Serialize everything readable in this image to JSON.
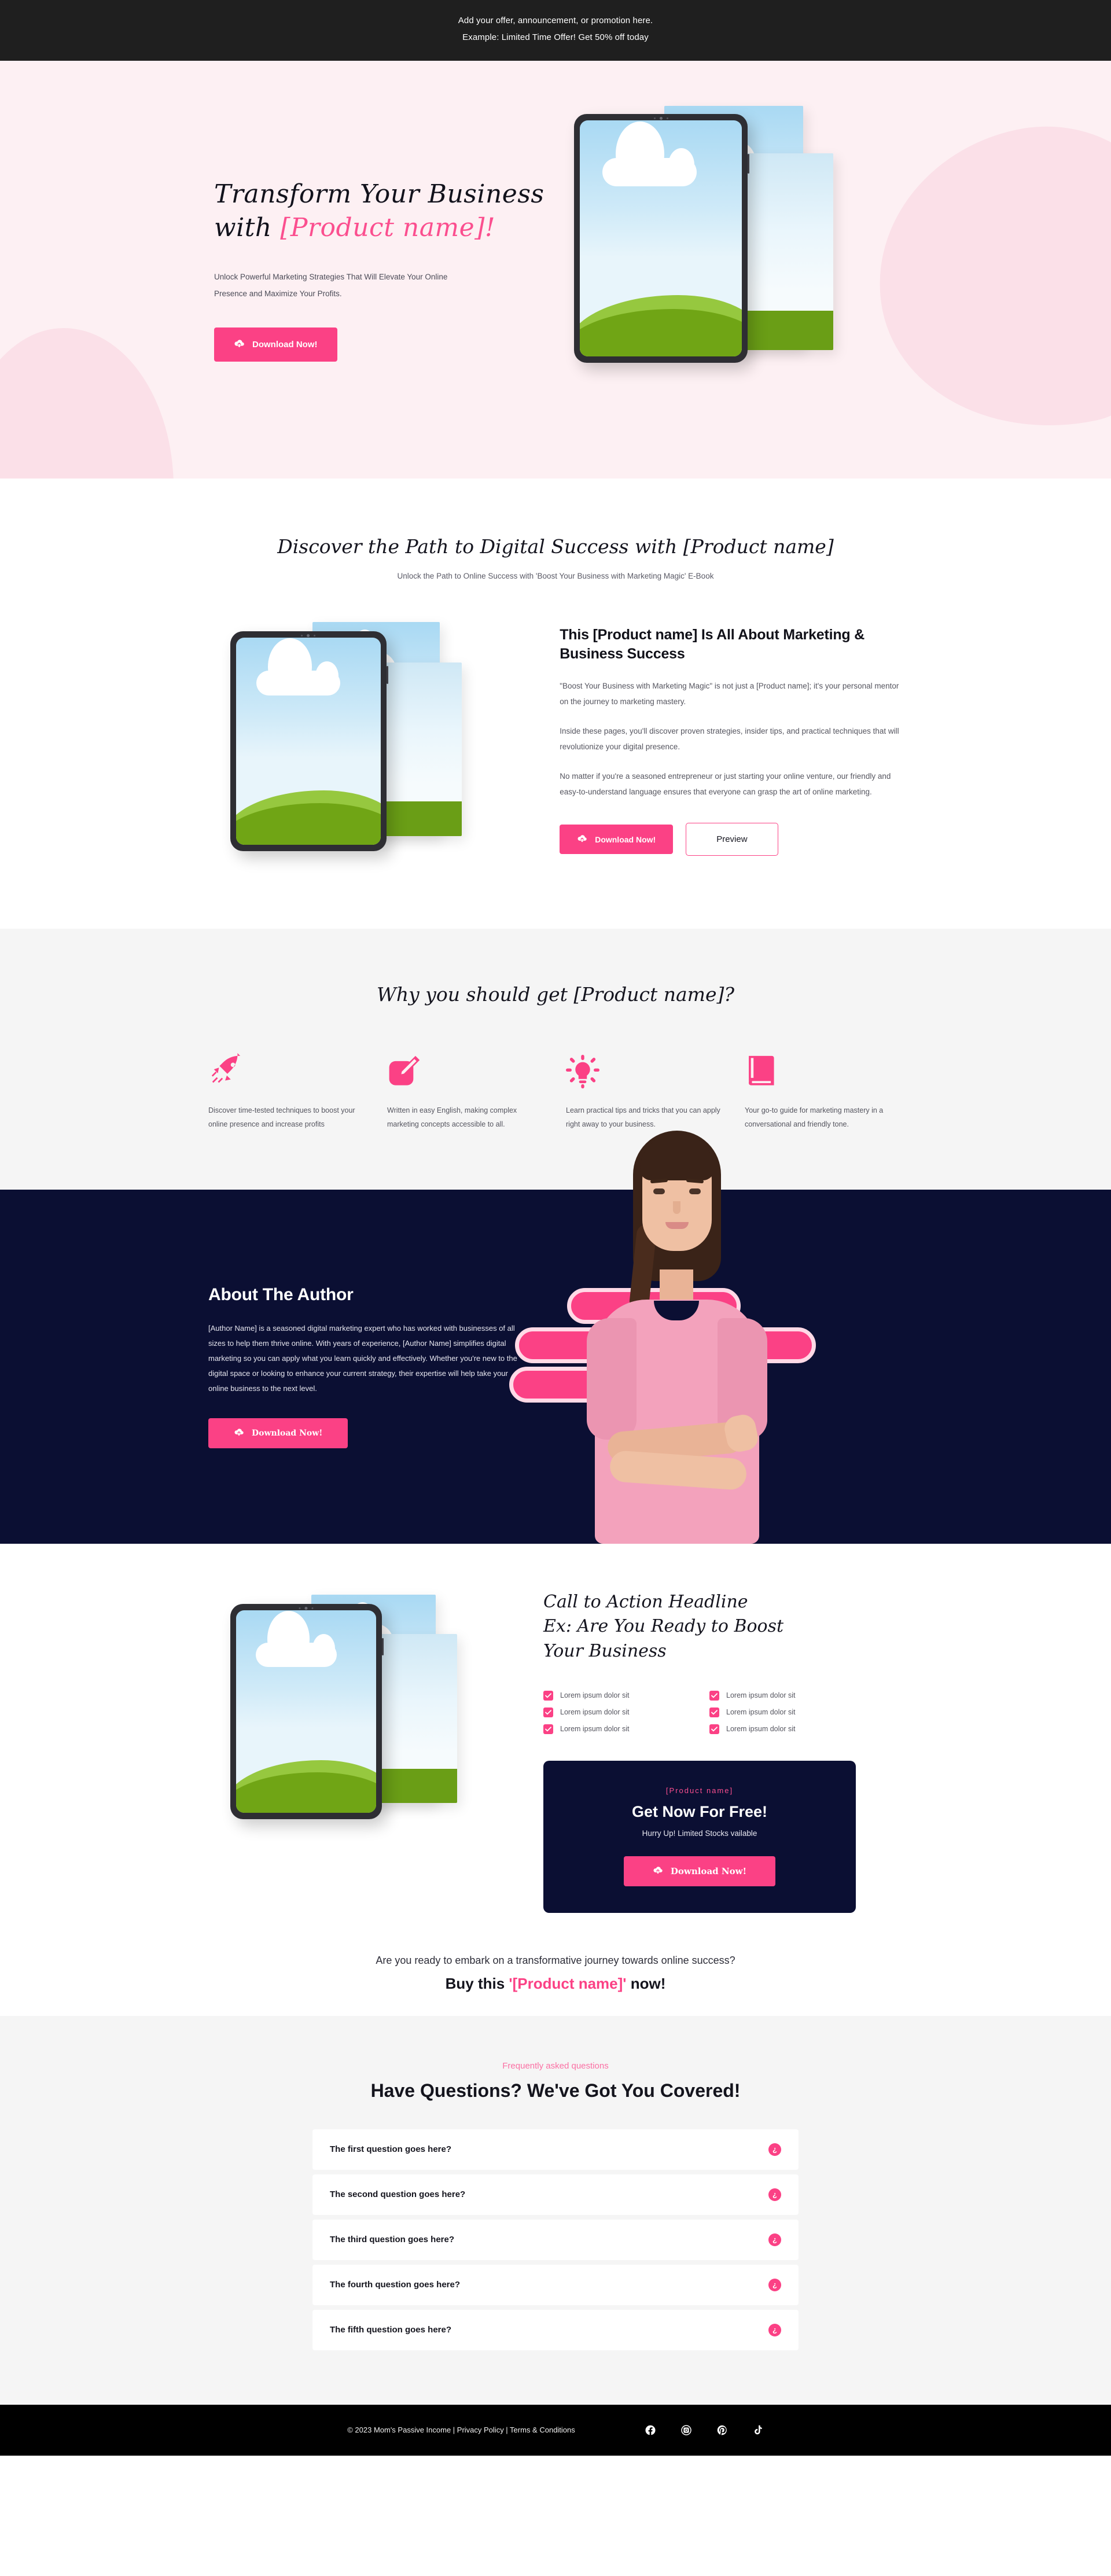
{
  "announcement": {
    "line1": "Add your offer, announcement, or promotion here.",
    "line2": "Example: Limited Time Offer! Get 50% off today"
  },
  "hero": {
    "heading_line1": "Transform Your Business",
    "heading_line2_prefix": "with ",
    "heading_line2_accent": "[Product name]!",
    "subtext": "Unlock Powerful Marketing Strategies That Will Elevate Your Online Presence and Maximize Your Profits.",
    "cta_label": "Download Now!",
    "cta_icon": "cloud-download-icon"
  },
  "discover": {
    "title": "Discover the Path to Digital Success with [Product name]",
    "subtitle": "Unlock the Path to Online Success with 'Boost Your Business with Marketing Magic' E-Book",
    "copy_heading": "This [Product name] Is All About Marketing & Business Success",
    "paragraphs": [
      "\"Boost Your Business with Marketing Magic\" is not just a [Product name]; it's your personal mentor on the journey to marketing mastery.",
      "Inside these pages, you'll discover proven strategies, insider tips, and practical techniques that will revolutionize your digital presence.",
      "No matter if you're a seasoned entrepreneur or just starting your online venture, our friendly and easy-to-understand language ensures that everyone can grasp the art of online marketing."
    ],
    "primary_cta": "Download Now!",
    "secondary_cta": "Preview"
  },
  "why": {
    "title": "Why you should get [Product name]?",
    "items": [
      {
        "icon": "rocket-icon",
        "text": "Discover time-tested techniques to boost your online presence and increase profits"
      },
      {
        "icon": "pencil-square-icon",
        "text": "Written in easy English, making complex marketing concepts accessible to all."
      },
      {
        "icon": "lightbulb-icon",
        "text": "Learn practical tips and tricks that you can apply right away to your business."
      },
      {
        "icon": "book-icon",
        "text": "Your go-to guide for marketing mastery in a conversational and friendly tone."
      }
    ]
  },
  "author": {
    "title": "About The Author",
    "body": "[Author Name] is a seasoned digital marketing expert who has worked with businesses of all sizes to help them thrive online. With years of experience, [Author Name] simplifies digital marketing so you can apply what you learn quickly and effectively. Whether you're new to the digital space or looking to enhance your current strategy, their expertise will help take your online business to the next level.",
    "cta_label": "Download Now!"
  },
  "cta": {
    "heading_line1": "Call to Action Headline",
    "heading_line2": "Ex: Are You Ready to Boost",
    "heading_line3": "Your Business",
    "checklist": [
      "Lorem ipsum dolor sit",
      "Lorem ipsum dolor sit",
      "Lorem ipsum dolor sit",
      "Lorem ipsum dolor sit",
      "Lorem ipsum dolor sit",
      "Lorem ipsum dolor sit"
    ],
    "offer_kicker": "[Product name]",
    "offer_heading": "Get Now For Free!",
    "offer_sub": "Hurry Up! Limited Stocks vailable",
    "offer_cta": "Download Now!",
    "closing_line1": "Are you ready to embark on a transformative journey towards online success?",
    "closing_prefix": "Buy this ",
    "closing_accent": "'[Product name]'",
    "closing_suffix": " now!"
  },
  "faq": {
    "kicker": "Frequently asked questions",
    "title": "Have Questions? We've Got You Covered!",
    "toggle_glyph": "¿",
    "items": [
      "The first question goes here?",
      "The second question goes here?",
      "The third question goes here?",
      "The fourth question goes here?",
      "The fifth question goes here?"
    ]
  },
  "footer": {
    "copyright": "© 2023 Mom's Passive Income | Privacy Policy | Terms & Conditions",
    "social": [
      "facebook-icon",
      "instagram-icon",
      "pinterest-icon",
      "tiktok-icon"
    ]
  },
  "colors": {
    "accent_pink": "#fb4185",
    "hero_bg": "#fdf0f3",
    "dark_navy": "#0b0f33",
    "light_gray": "#f5f5f5",
    "announce_bg": "#1f1f1f"
  }
}
